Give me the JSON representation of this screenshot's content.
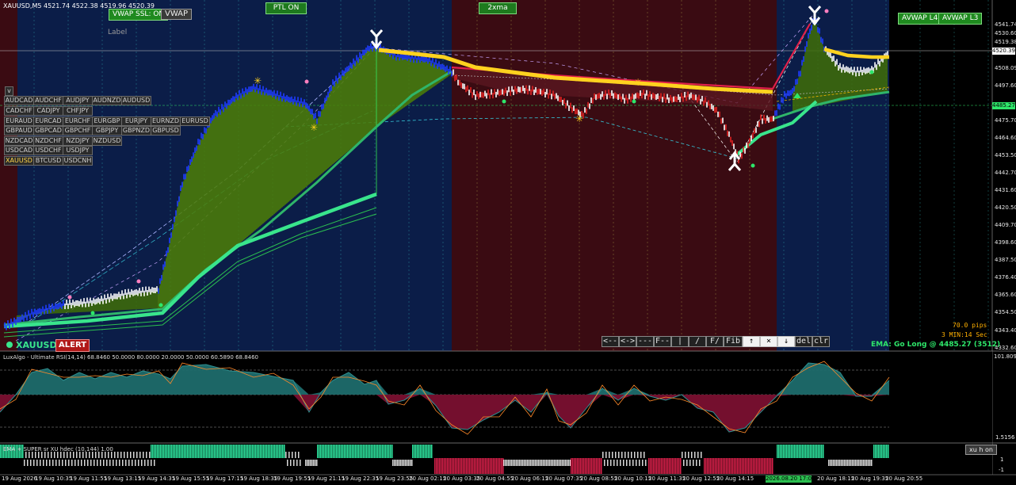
{
  "header": {
    "symbol_info": "XAUUSD,M5  4521.74 4522.38 4519.96 4520.39",
    "vwap_ssl_button": "VWAP SSL: ON",
    "vwap_button": "VWAP",
    "label_text": "Label",
    "ptl_button": "PTL ON",
    "ema_toggle": "2xma",
    "avwap_l4": "AVWAP L4",
    "avwap_l3": "AVWAP L3"
  },
  "symbol_panel": {
    "collapse": "v",
    "pairs": [
      [
        "AUDCAD",
        "AUDCHF",
        "AUDJPY",
        "AUDNZD",
        "AUDUSD"
      ],
      [
        "CADCHF",
        "CADJPY",
        "CHFJPY"
      ],
      [
        "EURAUD",
        "EURCAD",
        "EURCHF",
        "EURGBP",
        "EURJPY",
        "EURNZD",
        "EURUSD"
      ],
      [
        "GBPAUD",
        "GBPCAD",
        "GBPCHF",
        "GBPJPY",
        "GBPNZD",
        "GBPUSD"
      ],
      [
        "NZDCAD",
        "NZDCHF",
        "NZDJPY",
        "NZDUSD"
      ],
      [
        "USDCAD",
        "USDCHF",
        "USDJPY"
      ],
      [
        "XAUUSD",
        "BTCUSD",
        "USDCNH"
      ]
    ],
    "active_pair": "XAUUSD"
  },
  "status": {
    "pips": "70.0 pips",
    "timer": "3 MIN:14 Sec",
    "ema_signal": "EMA: Go Long @ 4485.27 (3512)",
    "watermark": "XAUUSD M5",
    "alert_badge": "ALERT"
  },
  "toolbar": [
    "<--",
    "<->",
    "---",
    "F--",
    "|",
    "/",
    "F/",
    "Fib",
    "↑",
    "×",
    "↓",
    "del",
    "clr"
  ],
  "price_axis": {
    "labels": [
      "4541.74",
      "4530.60",
      "4519.38",
      "4508.09",
      "4497.60",
      "4475.70",
      "4464.60",
      "4453.50",
      "4442.70",
      "4431.60",
      "4420.50",
      "4409.70",
      "4398.60",
      "4387.50",
      "4376.40",
      "4365.60",
      "4354.50",
      "4343.40",
      "4332.60"
    ],
    "current_price": "4520.39",
    "level_price": "4485.27"
  },
  "rsi_panel": {
    "title": "LuxAlgo - Ultimate RSI(14,14) 68.8460 50.0000 80.0000 20.0000 50.0000 60.5890 68.8460",
    "top_value": "101.8098",
    "bottom_value": "1.5156"
  },
  "bottom_panel": {
    "title": "EMA + SUPER sr  XU hdec (10,144) 1.00",
    "button": "xu h on",
    "top_value": "1",
    "bottom_value": "-1"
  },
  "time_axis": {
    "labels": [
      "19 Aug 2026",
      "19 Aug 10:35",
      "19 Aug 11:55",
      "19 Aug 13:15",
      "19 Aug 14:35",
      "19 Aug 15:55",
      "19 Aug 17:15",
      "19 Aug 18:35",
      "19 Aug 19:55",
      "19 Aug 21:15",
      "19 Aug 22:35",
      "19 Aug 23:55",
      "20 Aug 02:15",
      "20 Aug 03:35",
      "20 Aug 04:55",
      "20 Aug 06:15",
      "20 Aug 07:35",
      "20 Aug 08:55",
      "20 Aug 10:15",
      "20 Aug 11:35",
      "20 Aug 12:55",
      "20 Aug 14:15",
      "2026.08.20 17:05",
      "20 Aug 18:15",
      "20 Aug 19:35",
      "20 Aug 20:55"
    ],
    "highlight": "2026.08.20 17:05"
  },
  "colors": {
    "bg_blue": "#0b1d48",
    "bg_red": "#3a0b12",
    "price_up": "#1e3cff",
    "price_down": "#e02020",
    "vwap_yellow": "#ffd21f",
    "ema_fast": "#39e58c",
    "ema_slow": "#2fb56a",
    "cloud": "#3f6d08",
    "label_orange": "#ffb000",
    "rsi_teal": "#1e6b6b",
    "rsi_magenta": "#7a1030",
    "hist_green": "#2ee6a0",
    "hist_red": "#d8204a"
  }
}
